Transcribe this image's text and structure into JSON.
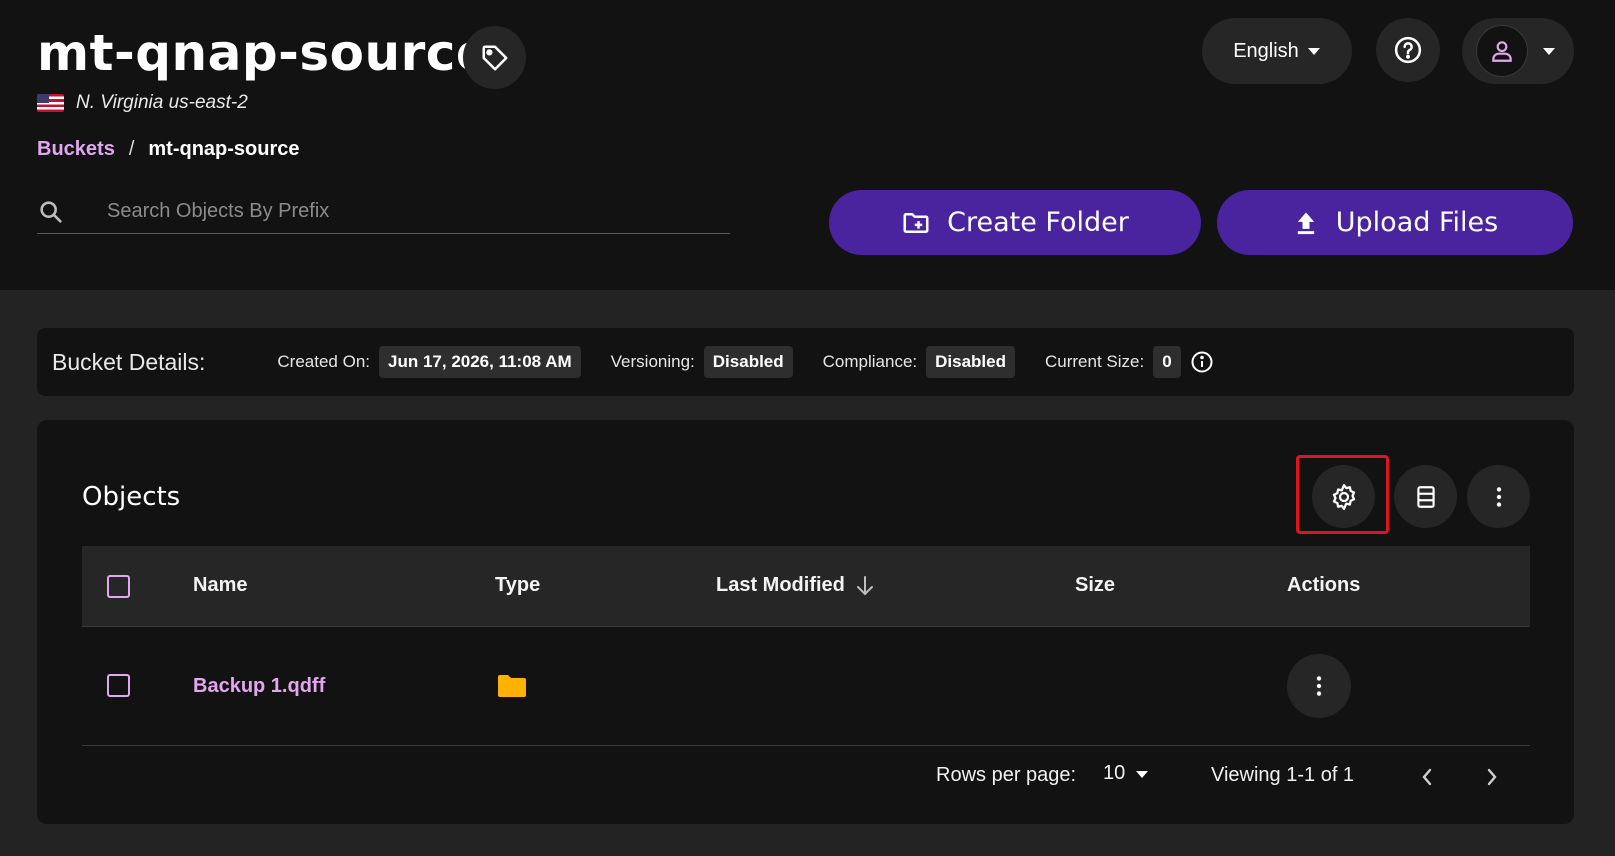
{
  "header": {
    "title": "mt-qnap-source",
    "region": "N. Virginia us-east-2",
    "breadcrumb": {
      "root": "Buckets",
      "separator": "/",
      "current": "mt-qnap-source"
    },
    "language": "English",
    "search": {
      "placeholder": "Search Objects By Prefix",
      "value": ""
    },
    "create_folder_label": "Create Folder",
    "upload_files_label": "Upload Files"
  },
  "bucket_details": {
    "label": "Bucket Details:",
    "created_on_label": "Created On:",
    "created_on_value": "Jun 17, 2026, 11:08 AM",
    "versioning_label": "Versioning:",
    "versioning_value": "Disabled",
    "compliance_label": "Compliance:",
    "compliance_value": "Disabled",
    "current_size_label": "Current Size:",
    "current_size_value": "0"
  },
  "objects": {
    "title": "Objects",
    "columns": {
      "name": "Name",
      "type": "Type",
      "last_modified": "Last Modified",
      "size": "Size",
      "actions": "Actions"
    },
    "rows": [
      {
        "name": "Backup 1.qdff",
        "type_icon": "folder-icon",
        "last_modified": "",
        "size": ""
      }
    ],
    "footer": {
      "rows_per_page_label": "Rows per page:",
      "rows_per_page_value": "10",
      "viewing": "Viewing 1-1 of 1"
    }
  },
  "colors": {
    "accent": "#4a249e",
    "link": "#e3a6f0",
    "folder": "#ffb300",
    "highlight": "#e0141e"
  }
}
